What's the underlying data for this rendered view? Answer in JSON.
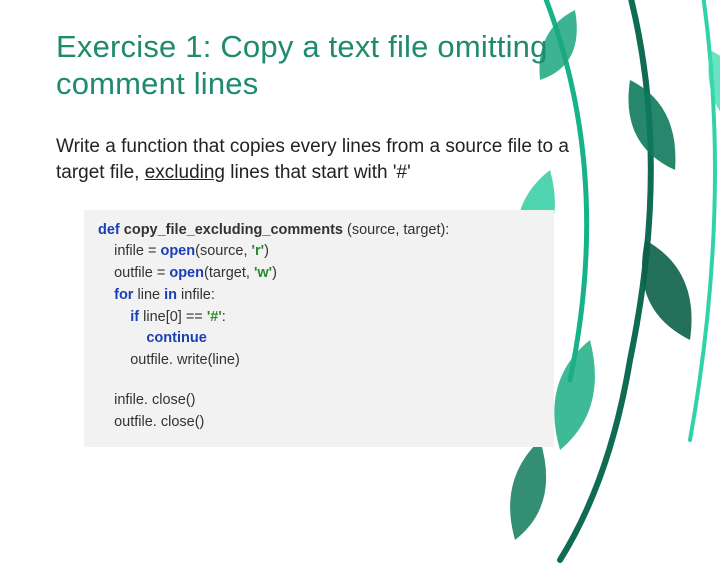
{
  "title": "Exercise 1: Copy a text file omitting comment lines",
  "description": {
    "pre": "Write a function that copies every lines from a source file to a target file, ",
    "underlined": "excluding",
    "post": " lines that start with '#'"
  },
  "code": {
    "def": "def",
    "fname": " copy_file_excluding_comments",
    "sig_end": " (source, target):",
    "l2a": "    infile = ",
    "open": "open",
    "l2b": "(source, ",
    "str_r": "'r'",
    "l2c": ")",
    "l3a": "    outfile = ",
    "l3b": "(target, ",
    "str_w": "'w'",
    "l3c": ")",
    "for": "for",
    "l4a": " line ",
    "in": "in",
    "l4b": " infile:",
    "if": "if",
    "l5a": " line[0] == ",
    "str_hash": "'#'",
    "l5b": ":",
    "continue": "continue",
    "l7": "        outfile. write(line)",
    "l8": "    infile. close()",
    "l9": "    outfile. close()"
  }
}
